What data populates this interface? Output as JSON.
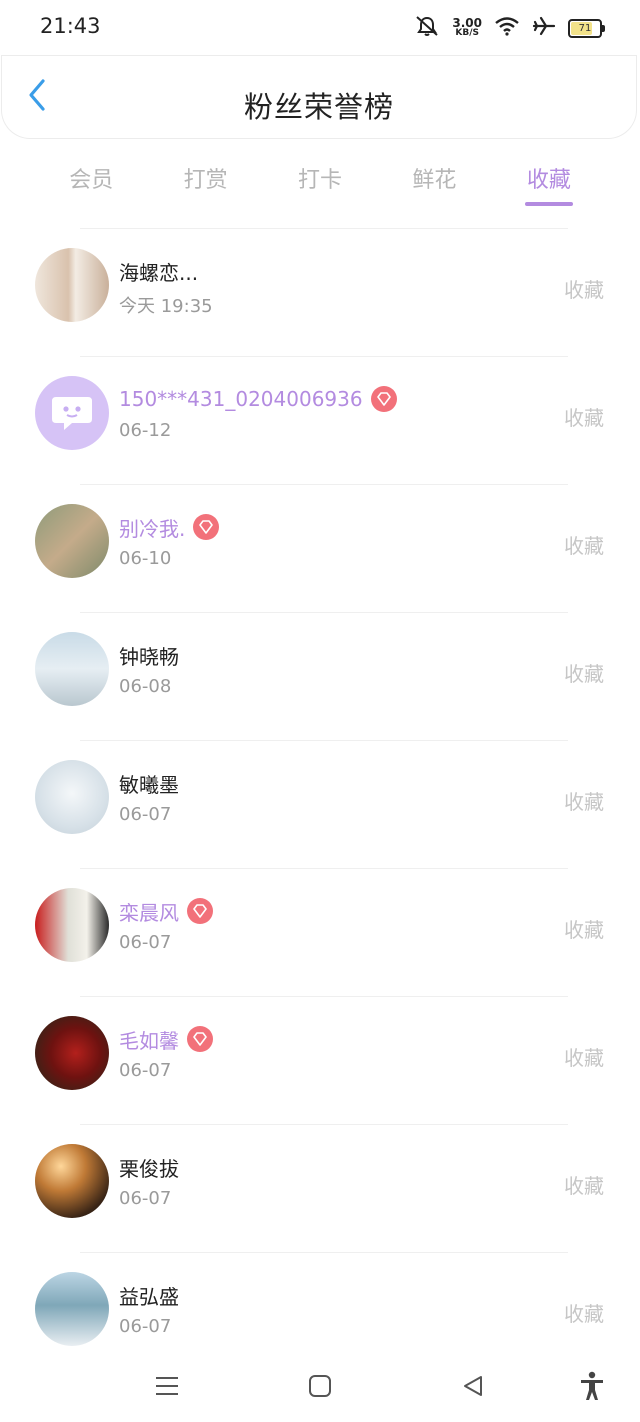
{
  "status_bar": {
    "time": "21:43",
    "net_speed_value": "3.00",
    "net_speed_unit": "KB/S",
    "battery_level": "71",
    "icons": [
      "mute-icon",
      "wifi-icon",
      "airplane-icon",
      "battery-icon"
    ]
  },
  "header": {
    "title": "粉丝荣誉榜",
    "back_icon": "chevron-left-icon"
  },
  "tabs": [
    {
      "label": "会员",
      "active": false
    },
    {
      "label": "打赏",
      "active": false
    },
    {
      "label": "打卡",
      "active": false
    },
    {
      "label": "鲜花",
      "active": false
    },
    {
      "label": "收藏",
      "active": true
    }
  ],
  "fans": [
    {
      "name": "海螺恋...",
      "date": "今天 19:35",
      "action": "收藏",
      "vip": false
    },
    {
      "name": "150***431_0204006936",
      "date": "06-12",
      "action": "收藏",
      "vip": true
    },
    {
      "name": "别冷我.",
      "date": "06-10",
      "action": "收藏",
      "vip": true
    },
    {
      "name": "钟晓畅",
      "date": "06-08",
      "action": "收藏",
      "vip": false
    },
    {
      "name": "敏曦墨",
      "date": "06-07",
      "action": "收藏",
      "vip": false
    },
    {
      "name": "栾晨风",
      "date": "06-07",
      "action": "收藏",
      "vip": true
    },
    {
      "name": "毛如馨",
      "date": "06-07",
      "action": "收藏",
      "vip": true
    },
    {
      "name": "栗俊拔",
      "date": "06-07",
      "action": "收藏",
      "vip": false
    },
    {
      "name": "益弘盛",
      "date": "06-07",
      "action": "收藏",
      "vip": false
    }
  ],
  "colors": {
    "accent": "#b38be0",
    "badge": "#f2717a",
    "back_arrow": "#3a9de8"
  },
  "nav_bar": {
    "icons": [
      "menu-icon",
      "home-square-icon",
      "back-triangle-icon",
      "accessibility-icon"
    ]
  }
}
